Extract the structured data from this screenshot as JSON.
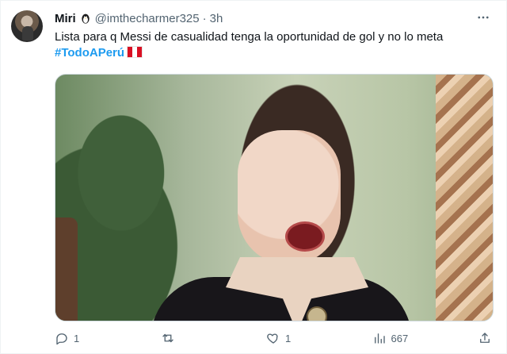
{
  "tweet": {
    "display_name": "Miri",
    "handle": "@imthecharmer325",
    "separator": "·",
    "time": "3h",
    "text": "Lista para q Messi de casualidad tenga la oportunidad de gol y no lo meta",
    "hashtag": "#TodoAPerú",
    "more_icon": "more-icon",
    "badge_icon": "penguin-icon",
    "flag_icon": "peru-flag-icon"
  },
  "actions": {
    "reply": {
      "icon": "reply-icon",
      "count": "1"
    },
    "retweet": {
      "icon": "retweet-icon",
      "count": ""
    },
    "like": {
      "icon": "heart-icon",
      "count": "1"
    },
    "views": {
      "icon": "views-icon",
      "count": "667"
    },
    "share": {
      "icon": "share-icon"
    }
  },
  "colors": {
    "accent": "#1d9bf0",
    "secondary_text": "#536471"
  }
}
